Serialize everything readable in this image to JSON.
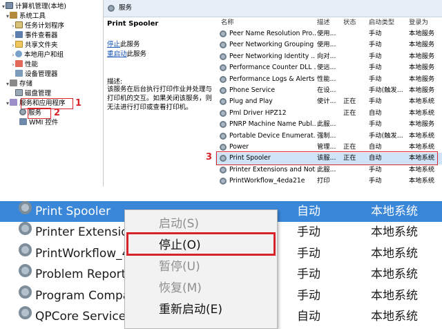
{
  "tree": {
    "root": "计算机管理(本地)",
    "system_tools": "系统工具",
    "task_scheduler": "任务计划程序",
    "event_viewer": "事件查看器",
    "shared_folders": "共享文件夹",
    "local_users": "本地用户和组",
    "performance": "性能",
    "device_manager": "设备管理器",
    "storage": "存储",
    "disk_management": "磁盘管理",
    "services_apps": "服务和应用程序",
    "services": "服务",
    "wmi": "WMI 控件"
  },
  "markers": {
    "one": "1",
    "two": "2",
    "three": "3"
  },
  "panel": {
    "title": "服务"
  },
  "description": {
    "service_title": "Print Spooler",
    "stop_link": "停止",
    "stop_rest": "此服务",
    "restart_link": "重启动",
    "restart_rest": "此服务",
    "label": "描述:",
    "text": "该服务在后台执行打印作业并处理与打印机的交互。如果关闭该服务，则无法进行打印或查看打印机。"
  },
  "columns": {
    "name": "名称",
    "desc": "描述",
    "status": "状态",
    "startup": "启动类型",
    "logon": "登录为"
  },
  "services": [
    {
      "name": "Peer Name Resolution Pro...",
      "desc": "使用...",
      "status": "",
      "startup": "手动",
      "logon": "本地服务"
    },
    {
      "name": "Peer Networking Grouping",
      "desc": "使用...",
      "status": "",
      "startup": "手动",
      "logon": "本地服务"
    },
    {
      "name": "Peer Networking Identity ...",
      "desc": "向对...",
      "status": "",
      "startup": "手动",
      "logon": "本地服务"
    },
    {
      "name": "Performance Counter DLL ...",
      "desc": "使远...",
      "status": "",
      "startup": "手动",
      "logon": "本地服务"
    },
    {
      "name": "Performance Logs & Alerts",
      "desc": "性能...",
      "status": "",
      "startup": "手动",
      "logon": "本地服务"
    },
    {
      "name": "Phone Service",
      "desc": "在设...",
      "status": "",
      "startup": "手动(触发...",
      "logon": "本地服务"
    },
    {
      "name": "Plug and Play",
      "desc": "使计...",
      "status": "正在",
      "startup": "手动",
      "logon": "本地系统"
    },
    {
      "name": "Pml Driver HPZ12",
      "desc": "",
      "status": "正在",
      "startup": "自动",
      "logon": "本地系统"
    },
    {
      "name": "PNRP Machine Name Publ...",
      "desc": "此服...",
      "status": "",
      "startup": "手动",
      "logon": "本地服务"
    },
    {
      "name": "Portable Device Enumerat...",
      "desc": "强制...",
      "status": "",
      "startup": "手动(触发...",
      "logon": "本地系统"
    },
    {
      "name": "Power",
      "desc": "管理...",
      "status": "正在",
      "startup": "自动",
      "logon": "本地系统"
    },
    {
      "name": "Print Spooler",
      "desc": "该服...",
      "status": "正在",
      "startup": "自动",
      "logon": "本地系统"
    },
    {
      "name": "Printer Extensions and Noti...",
      "desc": "此服...",
      "status": "",
      "startup": "手动",
      "logon": "本地系统"
    },
    {
      "name": "PrintWorkflow_4eda21e",
      "desc": "打印",
      "status": "",
      "startup": "手动",
      "logon": "本地系统"
    }
  ],
  "zoom_rows": [
    {
      "name": "Print Spooler",
      "startup": "自动",
      "logon": "本地系统"
    },
    {
      "name": "Printer Extension",
      "startup": "手动",
      "logon": "本地系统"
    },
    {
      "name": "PrintWorkflow_4",
      "startup": "手动",
      "logon": "本地系统"
    },
    {
      "name": "Problem Reports",
      "startup": "手动",
      "logon": "本地系统"
    },
    {
      "name": "Program Compa",
      "startup": "手动",
      "logon": "本地系统"
    },
    {
      "name": "QPCore Service",
      "startup": "自动",
      "logon": "本地系统"
    }
  ],
  "context_menu": {
    "start": "启动(S)",
    "stop": "停止(O)",
    "pause": "暂停(U)",
    "resume": "恢复(M)",
    "restart": "重新启动(E)"
  },
  "colors": {
    "annotation": "#d8232a",
    "selection_zoom": "#3a86d8",
    "selection_list": "#cfe3f9",
    "link": "#1a56b8"
  }
}
